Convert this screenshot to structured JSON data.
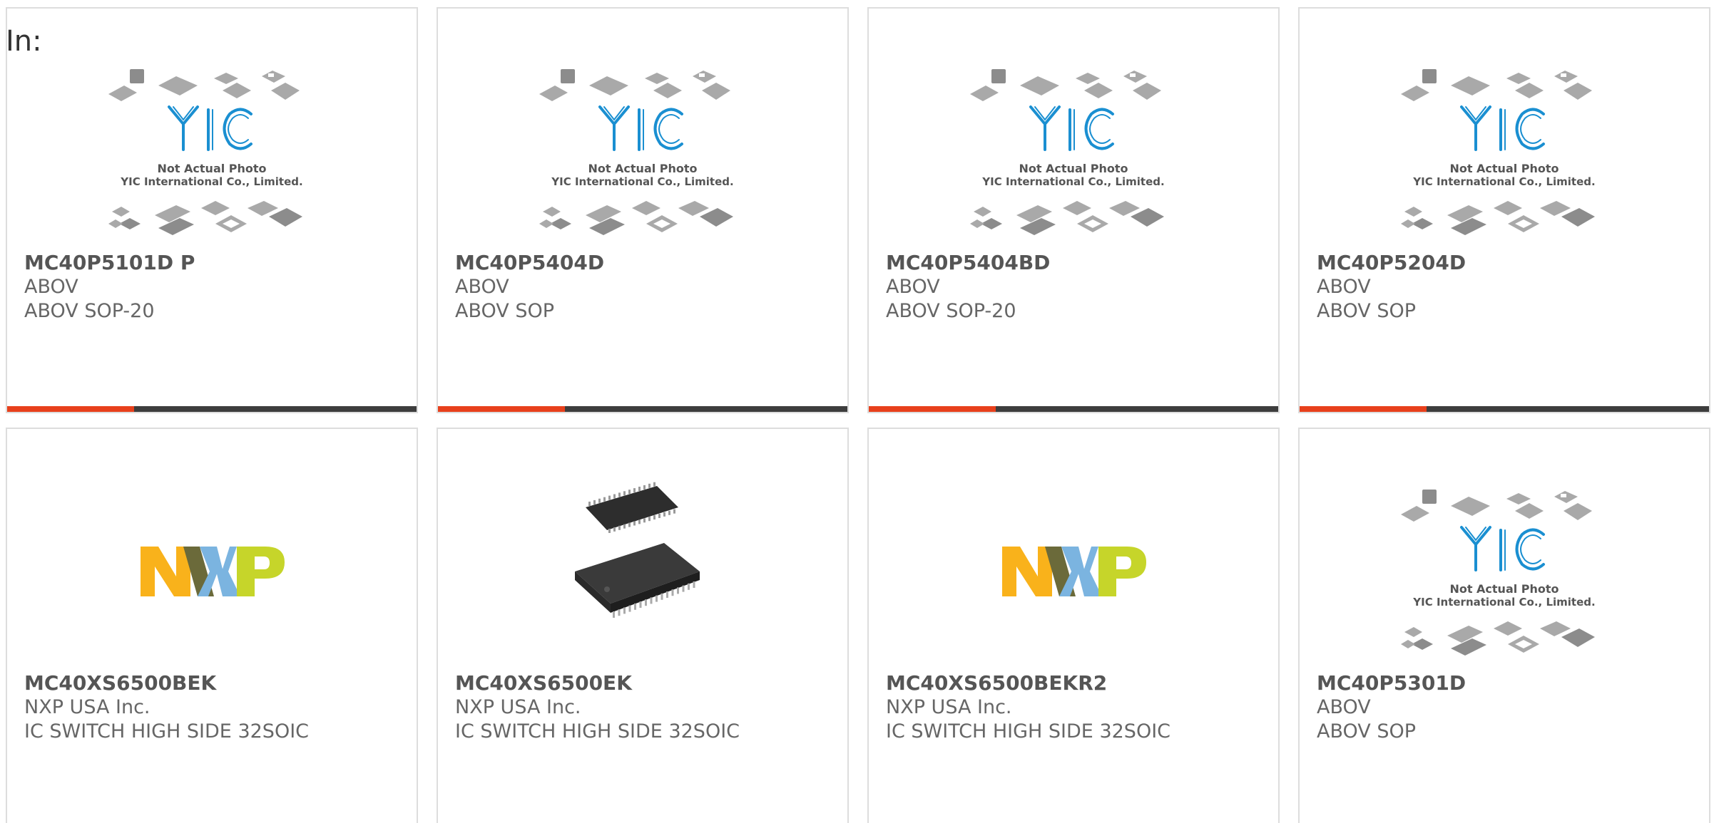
{
  "header": {
    "in_label": "In:"
  },
  "placeholder": {
    "line1": "Not Actual Photo",
    "line2": "YIC International Co., Limited.",
    "logo": "YIC"
  },
  "colors": {
    "accent": "#e8401c",
    "bar_track": "#3d3d3d",
    "yic_blue": "#1a8fd1",
    "nxp_yellow": "#f9b21b",
    "nxp_blue": "#7bb4e0",
    "nxp_green": "#c6d52a"
  },
  "products": [
    {
      "part": "MC40P5101D P",
      "manufacturer": "ABOV",
      "description": "ABOV SOP-20",
      "image": "placeholder",
      "progress": 0.31
    },
    {
      "part": "MC40P5404D",
      "manufacturer": "ABOV",
      "description": "ABOV SOP",
      "image": "placeholder",
      "progress": 0.31
    },
    {
      "part": "MC40P5404BD",
      "manufacturer": "ABOV",
      "description": "ABOV SOP-20",
      "image": "placeholder",
      "progress": 0.31
    },
    {
      "part": "MC40P5204D",
      "manufacturer": "ABOV",
      "description": "ABOV SOP",
      "image": "placeholder",
      "progress": 0.31
    },
    {
      "part": "MC40XS6500BEK",
      "manufacturer": "NXP USA Inc.",
      "description": "IC SWITCH HIGH SIDE 32SOIC",
      "image": "nxp-logo"
    },
    {
      "part": "MC40XS6500EK",
      "manufacturer": "NXP USA Inc.",
      "description": "IC SWITCH HIGH SIDE 32SOIC",
      "image": "chip-photo"
    },
    {
      "part": "MC40XS6500BEKR2",
      "manufacturer": "NXP USA Inc.",
      "description": "IC SWITCH HIGH SIDE 32SOIC",
      "image": "nxp-logo"
    },
    {
      "part": "MC40P5301D",
      "manufacturer": "ABOV",
      "description": "ABOV SOP",
      "image": "placeholder"
    }
  ]
}
